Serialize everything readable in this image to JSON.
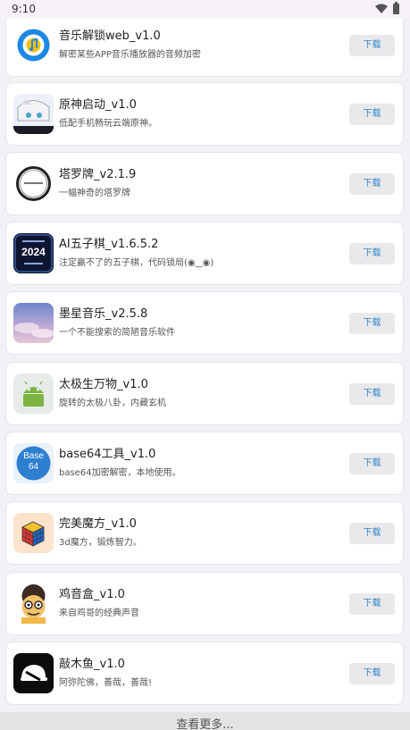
{
  "status": {
    "time": "9:10"
  },
  "download_label": "下载",
  "more_label": "查看更多...",
  "apps": [
    {
      "name": "音乐解锁web_v1.0",
      "desc": "解密某些APP音乐播放器的音频加密",
      "icon": "music-unlock-icon"
    },
    {
      "name": "原神启动_v1.0",
      "desc": "低配手机畅玩云端原神。",
      "icon": "anime-girl-icon"
    },
    {
      "name": "塔罗牌_v2.1.9",
      "desc": "一幅神奇的塔罗牌",
      "icon": "tarot-circle-icon"
    },
    {
      "name": "AI五子棋_v1.6.5.2",
      "desc": "注定赢不了的五子棋，代码锁局(◉‿◉)",
      "icon": "gomoku-icon",
      "icon_text": "2024"
    },
    {
      "name": "墨星音乐_v2.5.8",
      "desc": "一个不能搜索的简陋音乐软件",
      "icon": "sky-clouds-icon"
    },
    {
      "name": "太极生万物_v1.0",
      "desc": "旋转的太极八卦，内藏玄机",
      "icon": "android-icon"
    },
    {
      "name": "base64工具_v1.0",
      "desc": "base64加密解密，本地使用。",
      "icon": "base64-icon",
      "icon_text": "Base\n64"
    },
    {
      "name": "完美魔方_v1.0",
      "desc": "3d魔方，锻炼智力。",
      "icon": "rubiks-cube-icon"
    },
    {
      "name": "鸡音盒_v1.0",
      "desc": "来自鸡哥的经典声音",
      "icon": "cartoon-face-icon"
    },
    {
      "name": "敲木鱼_v1.0",
      "desc": "阿弥陀佛，善哉，善哉!",
      "icon": "wooden-fish-icon"
    }
  ]
}
